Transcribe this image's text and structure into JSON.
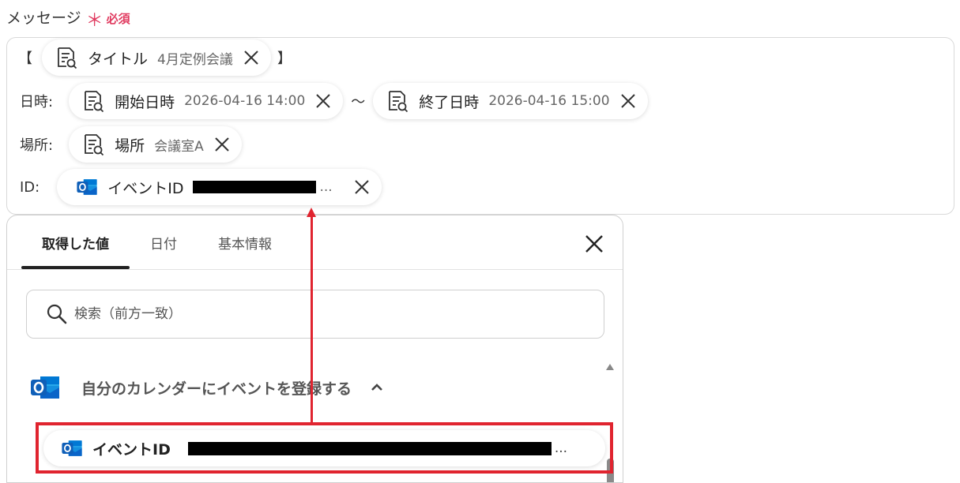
{
  "field": {
    "label": "メッセージ",
    "required_mark": "＊",
    "required_text": "必須"
  },
  "editor": {
    "title_line": {
      "open_bracket": "【",
      "close_bracket": "】",
      "pill": {
        "icon": "document-search-icon",
        "label": "タイトル",
        "value": "4月定例会議"
      }
    },
    "datetime_line": {
      "prefix": "日時:",
      "separator": "〜",
      "start_pill": {
        "icon": "document-search-icon",
        "label": "開始日時",
        "value": "2026-04-16 14:00"
      },
      "end_pill": {
        "icon": "document-search-icon",
        "label": "終了日時",
        "value": "2026-04-16 15:00"
      }
    },
    "place_line": {
      "prefix": "場所:",
      "pill": {
        "icon": "document-search-icon",
        "label": "場所",
        "value": "会議室A"
      }
    },
    "id_line": {
      "prefix": "ID:",
      "pill": {
        "icon": "outlook-icon",
        "label": "イベントID",
        "value_suffix": "..."
      }
    }
  },
  "panel": {
    "tabs": [
      {
        "label": "取得した値",
        "active": true
      },
      {
        "label": "日付"
      },
      {
        "label": "基本情報"
      }
    ],
    "search_placeholder": "検索（前方一致）",
    "group": {
      "icon": "outlook-icon",
      "title": "自分のカレンダーにイベントを登録する",
      "expanded": true
    },
    "items": [
      {
        "icon": "outlook-icon",
        "label": "イベントID",
        "value_suffix": "..."
      }
    ]
  },
  "colors": {
    "required": "#e03a5f",
    "highlight": "#e0242f",
    "outlook_blue": "#0a64c8"
  }
}
